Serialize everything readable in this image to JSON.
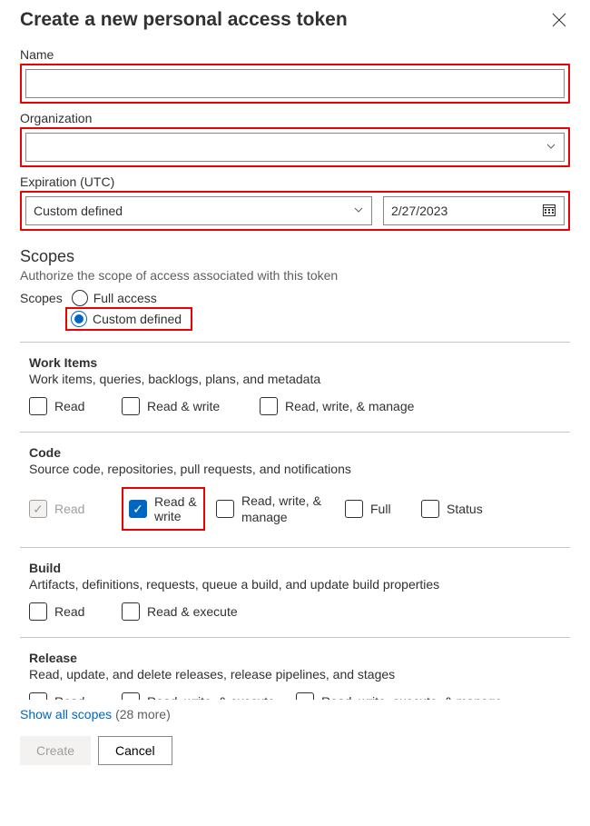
{
  "header": {
    "title": "Create a new personal access token"
  },
  "fields": {
    "name_label": "Name",
    "name_value": "",
    "org_label": "Organization",
    "org_value": "",
    "exp_label": "Expiration (UTC)",
    "exp_select": "Custom defined",
    "exp_date": "2/27/2023"
  },
  "scopes": {
    "heading": "Scopes",
    "sub": "Authorize the scope of access associated with this token",
    "group_label": "Scopes",
    "full_label": "Full access",
    "custom_label": "Custom defined"
  },
  "sections": [
    {
      "id": "work-items",
      "title": "Work Items",
      "desc": "Work items, queries, backlogs, plans, and metadata",
      "perms": [
        {
          "id": "read",
          "label": "Read"
        },
        {
          "id": "read-write",
          "label": "Read & write"
        },
        {
          "id": "read-write-manage",
          "label": "Read, write, & manage"
        }
      ]
    },
    {
      "id": "code",
      "title": "Code",
      "desc": "Source code, repositories, pull requests, and notifications",
      "perms": [
        {
          "id": "read",
          "label": "Read",
          "disabled": true,
          "checked": true
        },
        {
          "id": "read-write",
          "label": "Read & write",
          "checked": true,
          "highlight": true,
          "multiline": true
        },
        {
          "id": "read-write-manage",
          "label": "Read, write, & manage",
          "multiline": true
        },
        {
          "id": "full",
          "label": "Full"
        },
        {
          "id": "status",
          "label": "Status"
        }
      ]
    },
    {
      "id": "build",
      "title": "Build",
      "desc": "Artifacts, definitions, requests, queue a build, and update build properties",
      "perms": [
        {
          "id": "read",
          "label": "Read"
        },
        {
          "id": "read-execute",
          "label": "Read & execute"
        }
      ]
    },
    {
      "id": "release",
      "title": "Release",
      "desc": "Read, update, and delete releases, release pipelines, and stages",
      "perms": [
        {
          "id": "read",
          "label": "Read"
        },
        {
          "id": "rwe",
          "label": "Read, write, & execute"
        },
        {
          "id": "rwem",
          "label": "Read, write, execute, & manage"
        }
      ]
    }
  ],
  "show_all": {
    "link": "Show all scopes",
    "count": "(28 more)"
  },
  "actions": {
    "create": "Create",
    "cancel": "Cancel"
  }
}
